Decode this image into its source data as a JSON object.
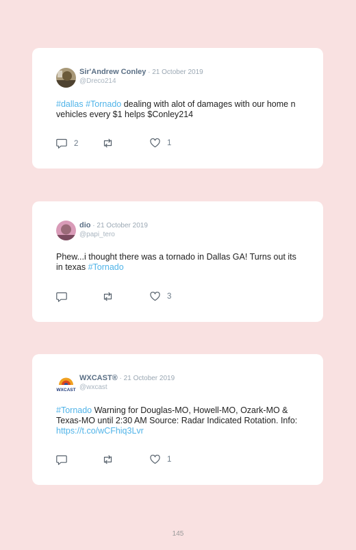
{
  "tweets": [
    {
      "name": "Sir'Andrew Conley",
      "date": " · 21 October 2019",
      "handle": "@Dreco214",
      "text_parts": [
        {
          "text": "#dallas",
          "tag": true
        },
        {
          "text": " ",
          "tag": false
        },
        {
          "text": "#Tornado",
          "tag": true
        },
        {
          "text": " dealing with alot of damages with our home n vehicles every $1 helps $Conley214",
          "tag": false
        }
      ],
      "replies": "2",
      "likes": "1",
      "avatar_color": "#6b5a3a"
    },
    {
      "name": "dio",
      "date": " · 21 October 2019",
      "handle": "@papi_tero",
      "text_parts": [
        {
          "text": "Phew...i thought there was a tornado in Dallas GA! Turns out its in texas ",
          "tag": false
        },
        {
          "text": "#Tornado",
          "tag": true
        }
      ],
      "replies": "",
      "likes": "3",
      "avatar_color": "#c98aa8"
    },
    {
      "name": "WXCAST®",
      "date": " · 21 October 2019",
      "handle": "@wxcast",
      "text_parts": [
        {
          "text": "#Tornado",
          "tag": true
        },
        {
          "text": " Warning for Douglas-MO, Howell-MO, Ozark-MO & Texas-MO until 2:30 AM Source: Radar Indicated Rotation. Info: ",
          "tag": false
        },
        {
          "text": "https://t.co/wCFhiq3Lvr",
          "tag": true
        }
      ],
      "replies": "",
      "likes": "1",
      "avatar_label": "WXCAST"
    }
  ],
  "page_number": "145",
  "colors": {
    "background": "#f9e1e1",
    "link": "#4fb3e8",
    "name": "#5a6f85"
  },
  "icons": [
    "comment-icon",
    "retweet-icon",
    "heart-icon"
  ]
}
